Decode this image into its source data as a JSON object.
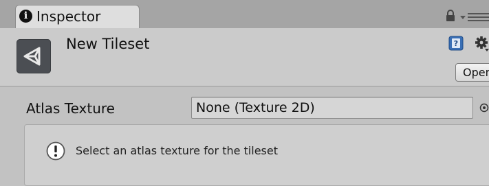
{
  "tab": {
    "label": "Inspector",
    "icon": "info-circle-icon"
  },
  "window_icons": [
    "lock-icon",
    "menu-icon"
  ],
  "header": {
    "asset_title": "New Tileset",
    "asset_icon": "unity-logo-icon",
    "help_icon": "help-icon",
    "settings_icon": "gear-icon",
    "open_label": "Open"
  },
  "fields": {
    "atlas_texture": {
      "label": "Atlas Texture",
      "value": "None (Texture 2D)",
      "picker_icon": "object-picker-icon"
    }
  },
  "helpbox": {
    "icon": "info-icon",
    "message": "Select an atlas texture for the tileset"
  },
  "colors": {
    "tabbar_bg": "#a5a5a5",
    "tab_bg": "#dedede",
    "header_bg": "#cbcbcb",
    "content_bg": "#c2c2c2",
    "helpbox_bg": "#cfcfcf",
    "asset_icon_bg": "#4b4e53"
  }
}
